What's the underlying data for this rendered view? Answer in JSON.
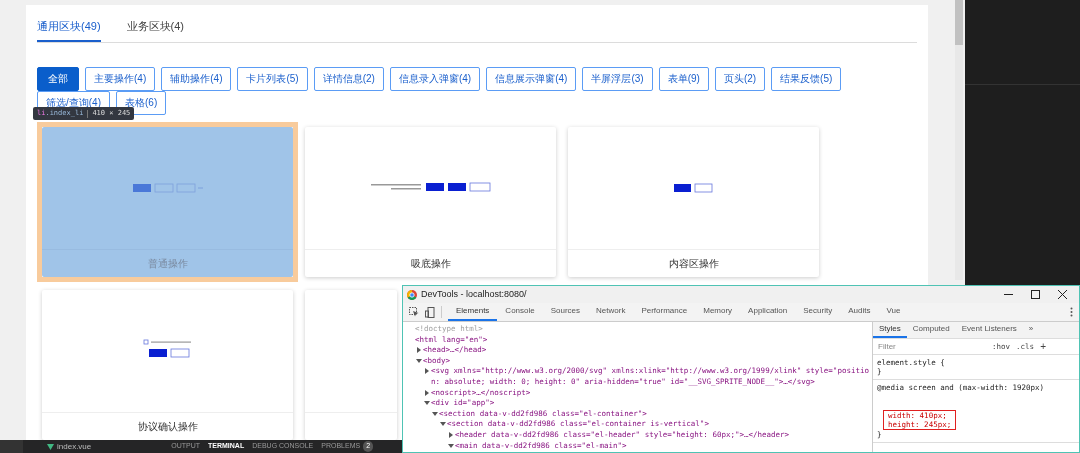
{
  "tabs": [
    {
      "label": "通用区块(49)",
      "selected": true
    },
    {
      "label": "业务区块(4)",
      "selected": false
    }
  ],
  "filters": [
    {
      "label": "全部",
      "selected": true
    },
    {
      "label": "主要操作(4)",
      "selected": false
    },
    {
      "label": "辅助操作(4)",
      "selected": false
    },
    {
      "label": "卡片列表(5)",
      "selected": false
    },
    {
      "label": "详情信息(2)",
      "selected": false
    },
    {
      "label": "信息录入弹窗(4)",
      "selected": false
    },
    {
      "label": "信息展示弹窗(4)",
      "selected": false
    },
    {
      "label": "半屏浮层(3)",
      "selected": false
    },
    {
      "label": "表单(9)",
      "selected": false
    },
    {
      "label": "页头(2)",
      "selected": false
    },
    {
      "label": "结果反馈(5)",
      "selected": false
    },
    {
      "label": "筛选/查询(4)",
      "selected": false
    },
    {
      "label": "表格(6)",
      "selected": false
    }
  ],
  "inspect_tooltip": {
    "tag": "li",
    "class": ".index_li",
    "size": "410 × 245"
  },
  "cards": [
    {
      "kind": "inline-buttons",
      "label": "普通操作",
      "highlighted": true
    },
    {
      "kind": "bottom-bar",
      "label": "吸底操作",
      "highlighted": false
    },
    {
      "kind": "left-buttons",
      "label": "内容区操作",
      "highlighted": false
    },
    {
      "kind": "agreement",
      "label": "协议确认操作",
      "highlighted": false
    },
    {
      "kind": "blank",
      "highlighted": false
    }
  ],
  "editor_panel": {
    "file": "index.vue",
    "tabs": [
      {
        "label": "OUTPUT",
        "selected": false
      },
      {
        "label": "TERMINAL",
        "selected": true
      },
      {
        "label": "DEBUG CONSOLE",
        "selected": false
      },
      {
        "label": "PROBLEMS",
        "selected": false,
        "badge": "2"
      }
    ]
  },
  "devtools": {
    "title": "DevTools - localhost:8080/",
    "tabs": [
      {
        "label": "Elements",
        "selected": true
      },
      {
        "label": "Console",
        "selected": false
      },
      {
        "label": "Sources",
        "selected": false
      },
      {
        "label": "Network",
        "selected": false
      },
      {
        "label": "Performance",
        "selected": false
      },
      {
        "label": "Memory",
        "selected": false
      },
      {
        "label": "Application",
        "selected": false
      },
      {
        "label": "Security",
        "selected": false
      },
      {
        "label": "Audits",
        "selected": false
      },
      {
        "label": "Vue",
        "selected": false
      }
    ],
    "dom": [
      {
        "text": "<!doctype html>",
        "kind": "doctype"
      },
      {
        "text": "<html lang=\"en\">",
        "children": [
          {
            "text": "<head>…</head>",
            "expanded": false
          },
          {
            "text": "<body>",
            "expanded": true,
            "children": [
              {
                "text": "<svg xmlns=\"http://www.w3.org/2000/svg\" xmlns:xlink=\"http://www.w3.org/1999/xlink\" style=\"position: absolute; width: 0; height: 0\" aria-hidden=\"true\" id=\"__SVG_SPRITE_NODE__\">…</svg>",
                "expanded": false
              },
              {
                "text": "<noscript>…</noscript>",
                "expanded": false
              },
              {
                "text": "<div id=\"app\">",
                "expanded": true,
                "children": [
                  {
                    "text": "<section data-v-dd2fd986 class=\"el-container\">",
                    "expanded": true,
                    "children": [
                      {
                        "text": "<section data-v-dd2fd986 class=\"el-container is-vertical\">",
                        "expanded": true,
                        "children": [
                          {
                            "text": "<header data-v-dd2fd986 class=\"el-header\" style=\"height: 60px;\">…</header>",
                            "expanded": false
                          },
                          {
                            "text": "<main data-v-dd2fd986 class=\"el-main\">",
                            "expanded": true
                          }
                        ]
                      }
                    ]
                  }
                ]
              }
            ]
          }
        ]
      }
    ],
    "styles_tabs": [
      {
        "label": "Styles",
        "selected": true
      },
      {
        "label": "Computed",
        "selected": false
      },
      {
        "label": "Event Listeners",
        "selected": false
      },
      {
        "label": "»",
        "selected": false
      }
    ],
    "filter_placeholder": "Filter",
    "hov": ":hov",
    "cls": ".cls",
    "add": "+",
    "rules": [
      {
        "lines": [
          "element.style {",
          "}"
        ]
      },
      {
        "lines": [
          "@media screen and (max-width: 1920px)"
        ],
        "boxed": [
          "width: 410px;",
          "height: 245px;"
        ],
        "close": "}"
      }
    ]
  }
}
